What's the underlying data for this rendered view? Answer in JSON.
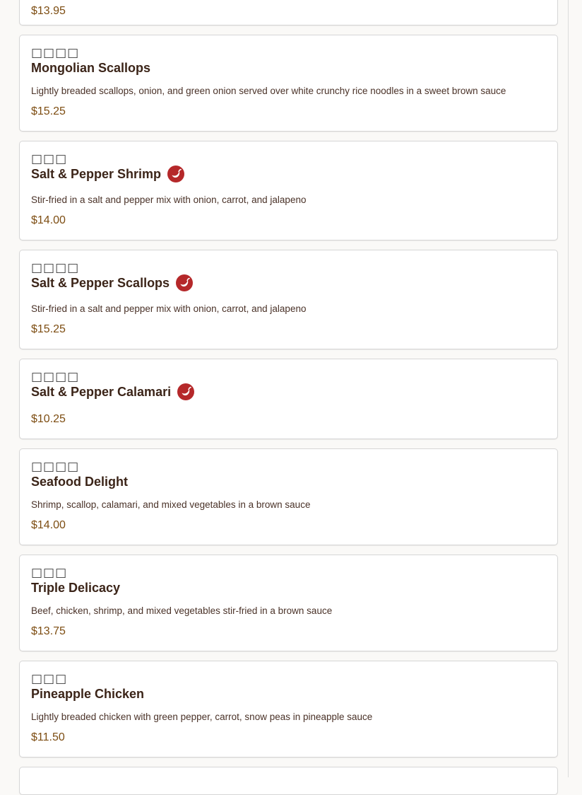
{
  "items": [
    {
      "price": "$13.95"
    },
    {
      "glyphs": "□□□□",
      "name": "Mongolian Scallops",
      "spicy": false,
      "description": "Lightly breaded scallops, onion, and green onion served over white crunchy rice noodles in a sweet brown sauce",
      "price": "$15.25"
    },
    {
      "glyphs": "□□□",
      "name": "Salt & Pepper Shrimp",
      "spicy": true,
      "description": "Stir-fried in a salt and pepper mix with onion, carrot, and jalapeno",
      "price": "$14.00"
    },
    {
      "glyphs": "□□□□",
      "name": "Salt & Pepper Scallops",
      "spicy": true,
      "description": "Stir-fried in a salt and pepper mix with onion, carrot, and jalapeno",
      "price": "$15.25"
    },
    {
      "glyphs": "□□□□",
      "name": "Salt & Pepper Calamari",
      "spicy": true,
      "price": "$10.25"
    },
    {
      "glyphs": "□□□□",
      "name": "Seafood Delight",
      "spicy": false,
      "description": "Shrimp, scallop, calamari, and mixed vegetables in a brown sauce",
      "price": "$14.00"
    },
    {
      "glyphs": "□□□",
      "name": "Triple Delicacy",
      "spicy": false,
      "description": "Beef, chicken, shrimp, and mixed vegetables stir-fried in a brown sauce",
      "price": "$13.75"
    },
    {
      "glyphs": "□□□",
      "name": "Pineapple Chicken",
      "spicy": false,
      "description": "Lightly breaded chicken with green pepper, carrot, snow peas in pineapple sauce",
      "price": "$11.50"
    }
  ],
  "icons": {
    "spicy": "chili-pepper-icon"
  },
  "colors": {
    "spicy_badge": "#b5282a",
    "price": "#7d4d12",
    "name": "#3b2418"
  }
}
